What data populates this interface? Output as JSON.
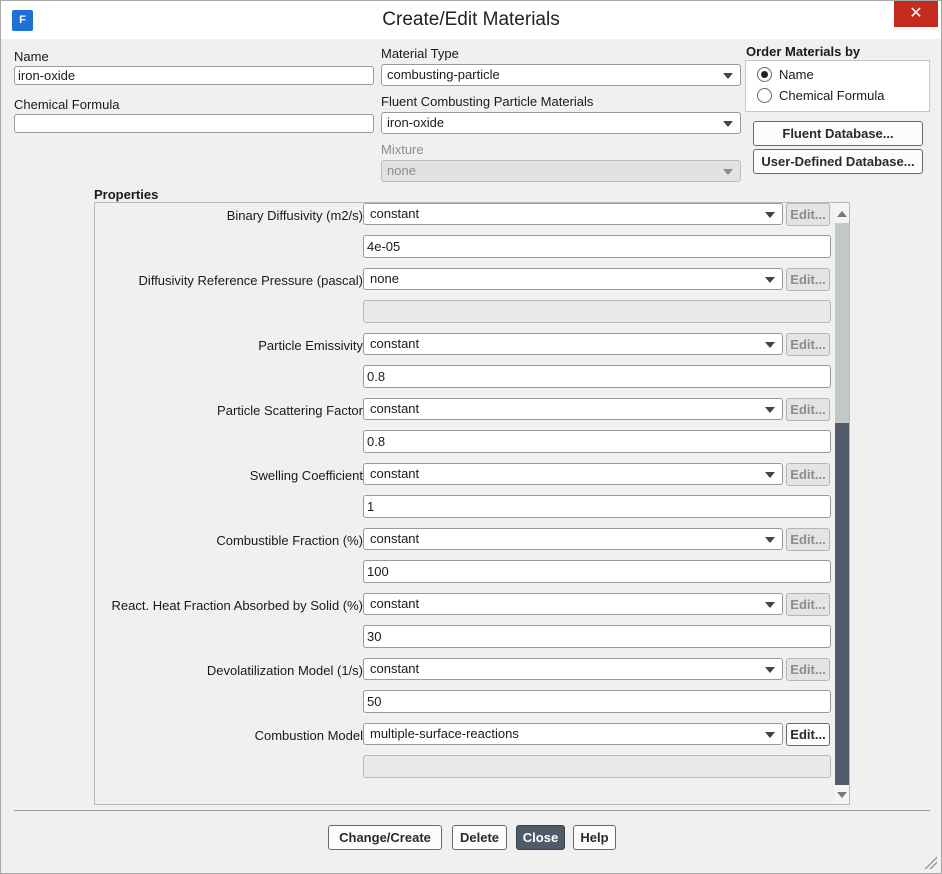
{
  "window": {
    "title": "Create/Edit Materials",
    "icon_letter": "F",
    "close_glyph": "✕"
  },
  "form": {
    "name_label": "Name",
    "name_value": "iron-oxide",
    "chemical_formula_label": "Chemical Formula",
    "chemical_formula_value": "",
    "material_type_label": "Material Type",
    "material_type_value": "combusting-particle",
    "fluent_materials_label": "Fluent Combusting Particle Materials",
    "fluent_materials_value": "iron-oxide",
    "mixture_label": "Mixture",
    "mixture_value": "none",
    "order_by_label": "Order Materials by",
    "order_options": [
      {
        "label": "Name",
        "selected": true
      },
      {
        "label": "Chemical Formula",
        "selected": false
      }
    ],
    "fluent_db_button": "Fluent Database...",
    "user_db_button": "User-Defined Database..."
  },
  "properties": {
    "title": "Properties",
    "edit_label": "Edit...",
    "rows": [
      {
        "label": "Binary Diffusivity (m2/s)",
        "method": "constant",
        "value": "4e-05",
        "edit_enabled": false,
        "value_enabled": true
      },
      {
        "label": "Diffusivity Reference Pressure (pascal)",
        "method": "none",
        "value": "",
        "edit_enabled": false,
        "value_enabled": false
      },
      {
        "label": "Particle Emissivity",
        "method": "constant",
        "value": "0.8",
        "edit_enabled": false,
        "value_enabled": true
      },
      {
        "label": "Particle Scattering Factor",
        "method": "constant",
        "value": "0.8",
        "edit_enabled": false,
        "value_enabled": true
      },
      {
        "label": "Swelling Coefficient",
        "method": "constant",
        "value": "1",
        "edit_enabled": false,
        "value_enabled": true
      },
      {
        "label": "Combustible Fraction (%)",
        "method": "constant",
        "value": "100",
        "edit_enabled": false,
        "value_enabled": true
      },
      {
        "label": "React. Heat Fraction Absorbed by Solid (%)",
        "method": "constant",
        "value": "30",
        "edit_enabled": false,
        "value_enabled": true
      },
      {
        "label": "Devolatilization Model (1/s)",
        "method": "constant",
        "value": "50",
        "edit_enabled": false,
        "value_enabled": true
      },
      {
        "label": "Combustion Model",
        "method": "multiple-surface-reactions",
        "value": "",
        "edit_enabled": true,
        "value_enabled": false
      }
    ]
  },
  "footer": {
    "change_create": "Change/Create",
    "delete": "Delete",
    "close": "Close",
    "help": "Help"
  }
}
